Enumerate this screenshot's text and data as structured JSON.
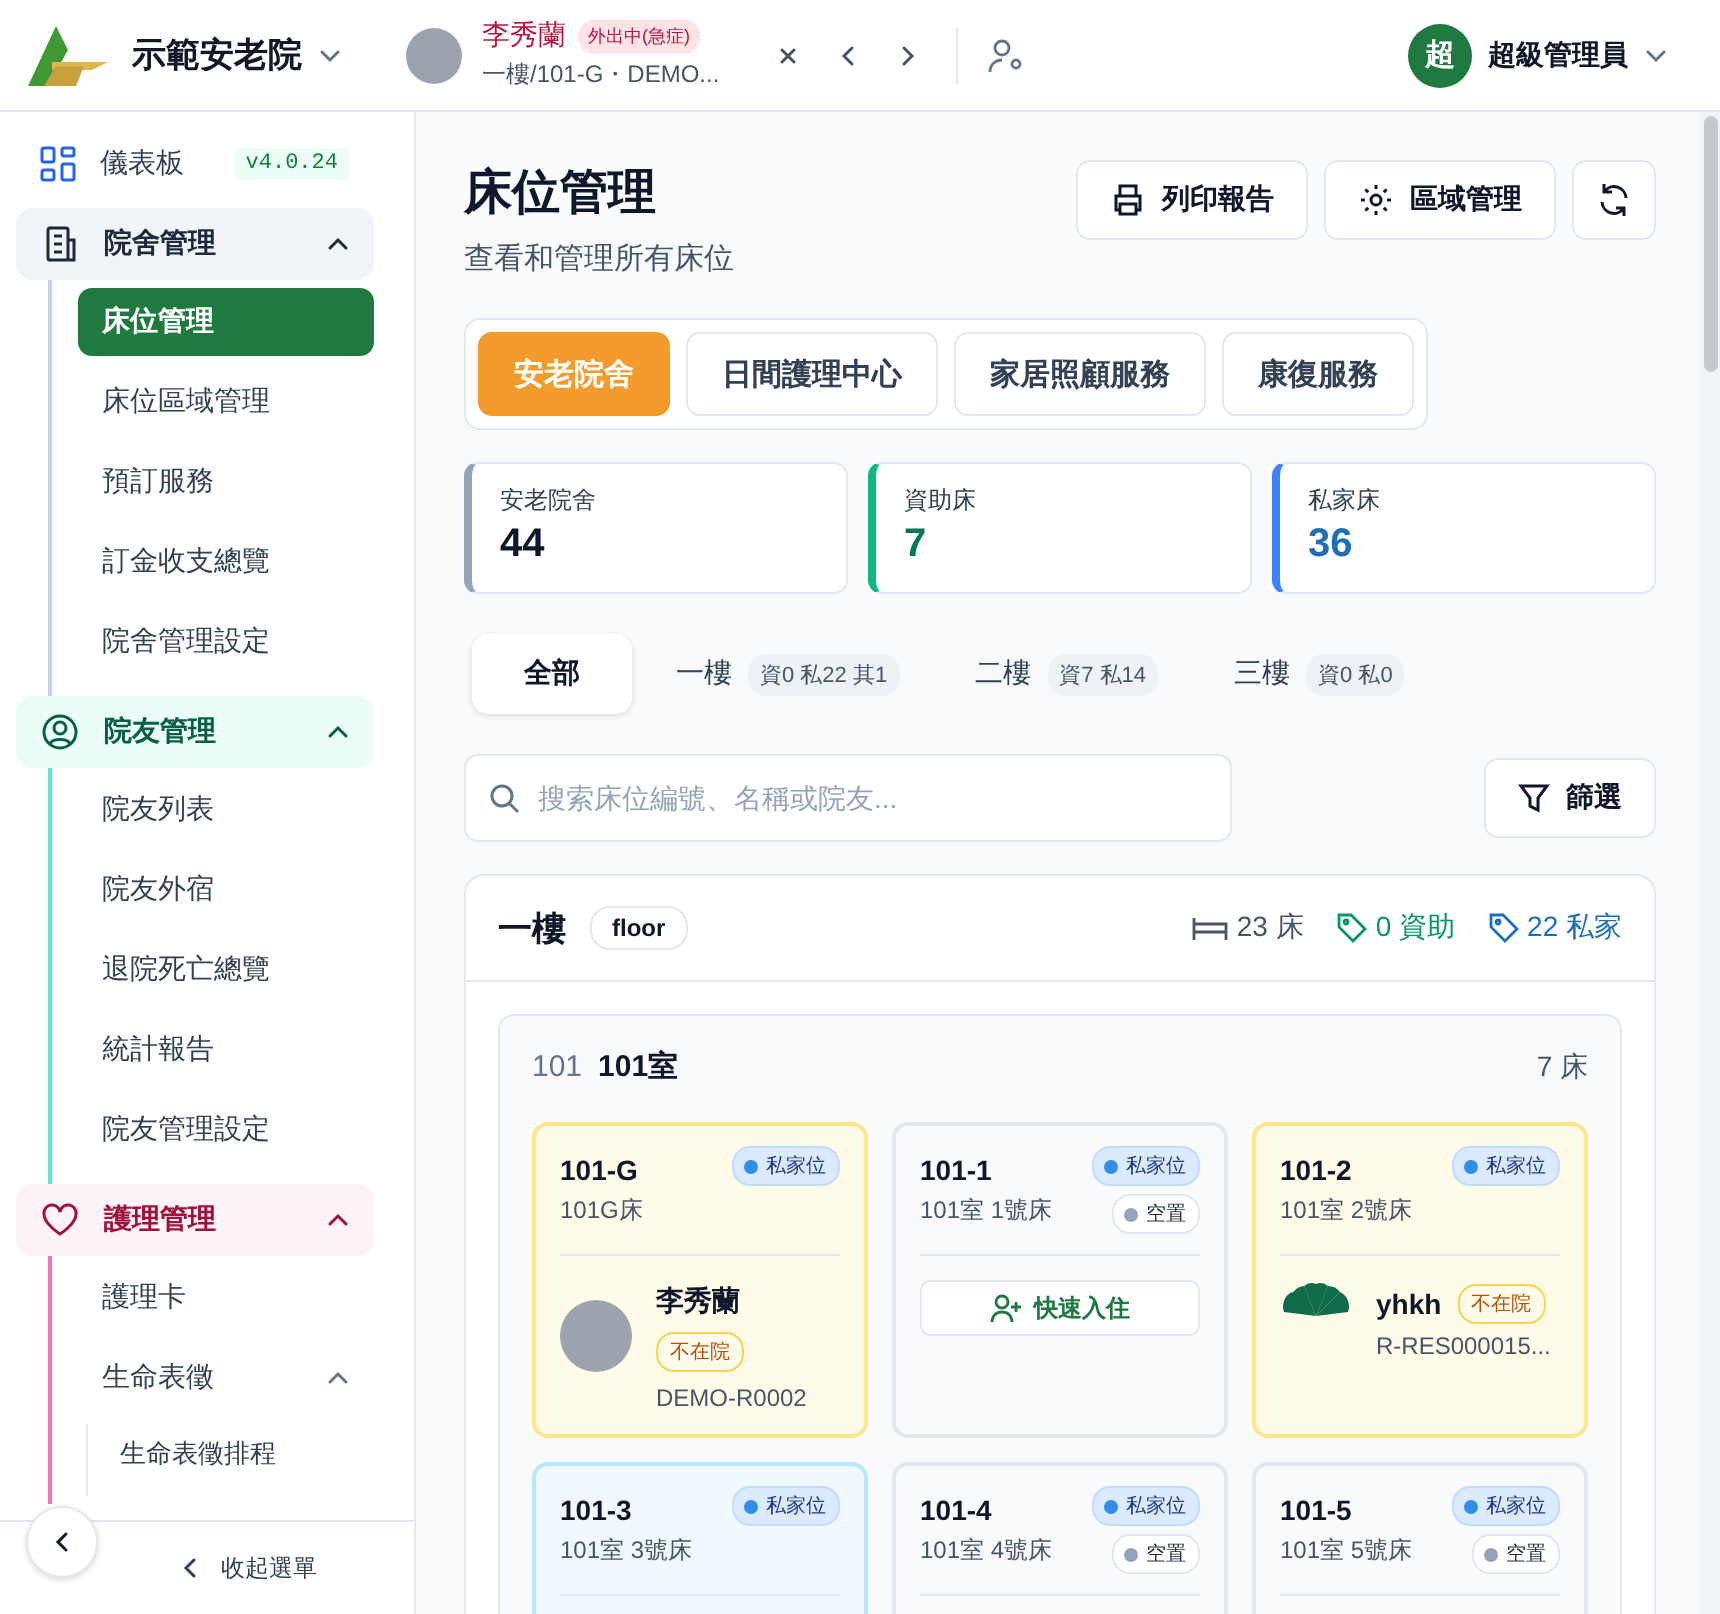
{
  "header": {
    "facility": "示範安老院",
    "resident": {
      "name": "李秀蘭",
      "status": "外出中(急症)",
      "location": "一樓/101-G・DEMO..."
    },
    "user": {
      "initial": "超",
      "name": "超級管理員"
    }
  },
  "sidebar": {
    "dashboard": {
      "label": "儀表板",
      "version": "v4.0.24"
    },
    "groups": [
      {
        "label": "院舍管理",
        "kind": "facility",
        "expanded": true,
        "items": [
          {
            "label": "床位管理",
            "selected": true
          },
          {
            "label": "床位區域管理",
            "selected": false
          },
          {
            "label": "預訂服務",
            "selected": false
          },
          {
            "label": "訂金收支總覽",
            "selected": false
          },
          {
            "label": "院舍管理設定",
            "selected": false
          }
        ]
      },
      {
        "label": "院友管理",
        "kind": "residents",
        "expanded": true,
        "items": [
          {
            "label": "院友列表",
            "selected": false
          },
          {
            "label": "院友外宿",
            "selected": false
          },
          {
            "label": "退院死亡總覽",
            "selected": false
          },
          {
            "label": "統計報告",
            "selected": false
          },
          {
            "label": "院友管理設定",
            "selected": false
          }
        ]
      },
      {
        "label": "護理管理",
        "kind": "care",
        "expanded": true,
        "items": [
          {
            "label": "護理卡",
            "selected": false
          },
          {
            "label": "生命表徵",
            "selected": false,
            "expanded": true,
            "children": [
              {
                "label": "生命表徵排程",
                "selected": false
              }
            ]
          }
        ]
      }
    ],
    "collapse": "收起選單"
  },
  "page": {
    "title": "床位管理",
    "subtitle": "查看和管理所有床位",
    "actions": [
      {
        "kind": "print",
        "label": "列印報告"
      },
      {
        "kind": "settings",
        "label": "區域管理"
      },
      {
        "kind": "refresh"
      }
    ],
    "service_tabs": [
      {
        "label": "安老院舍",
        "selected": true
      },
      {
        "label": "日間護理中心",
        "selected": false
      },
      {
        "label": "家居照顧服務",
        "selected": false
      },
      {
        "label": "康復服務",
        "selected": false
      }
    ],
    "stats": [
      {
        "label": "安老院舍",
        "value": "44",
        "kind": "total"
      },
      {
        "label": "資助床",
        "value": "7",
        "kind": "subsidized"
      },
      {
        "label": "私家床",
        "value": "36",
        "kind": "private"
      }
    ],
    "floor_tabs": [
      {
        "label": "全部",
        "selected": true
      },
      {
        "label": "一樓",
        "counts": "資0 私22 其1",
        "selected": false
      },
      {
        "label": "二樓",
        "counts": "資7 私14",
        "selected": false
      },
      {
        "label": "三樓",
        "counts": "資0 私0",
        "selected": false
      }
    ],
    "search": {
      "placeholder": "搜索床位編號、名稱或院友..."
    },
    "filter": "篩選",
    "floor": {
      "name": "一樓",
      "tag": "floor",
      "beds": "23 床",
      "subsidized": "0 資助",
      "private": "22 私家",
      "room": {
        "code": "101",
        "name": "101室",
        "beds": "7 床",
        "cards": [
          {
            "code": "101-G",
            "desc": "101G床",
            "category": "私家位",
            "kind": "absent",
            "resident": {
              "kind": "photo",
              "name": "李秀蘭",
              "badge": "不在院",
              "id": "DEMO-R0002"
            }
          },
          {
            "code": "101-1",
            "desc": "101室 1號床",
            "category": "私家位",
            "kind": "vacant",
            "vacancy": "空置",
            "action": "快速入住"
          },
          {
            "code": "101-2",
            "desc": "101室 2號床",
            "category": "私家位",
            "kind": "absent",
            "resident": {
              "kind": "logo",
              "name": "yhkh",
              "badge": "不在院",
              "id": "R-RES000015..."
            }
          },
          {
            "code": "101-3",
            "desc": "101室 3號床",
            "category": "私家位",
            "kind": "occupied"
          },
          {
            "code": "101-4",
            "desc": "101室 4號床",
            "category": "私家位",
            "kind": "vacant",
            "vacancy": "空置"
          },
          {
            "code": "101-5",
            "desc": "101室 5號床",
            "category": "私家位",
            "kind": "vacant",
            "vacancy": "空置"
          }
        ]
      }
    }
  }
}
